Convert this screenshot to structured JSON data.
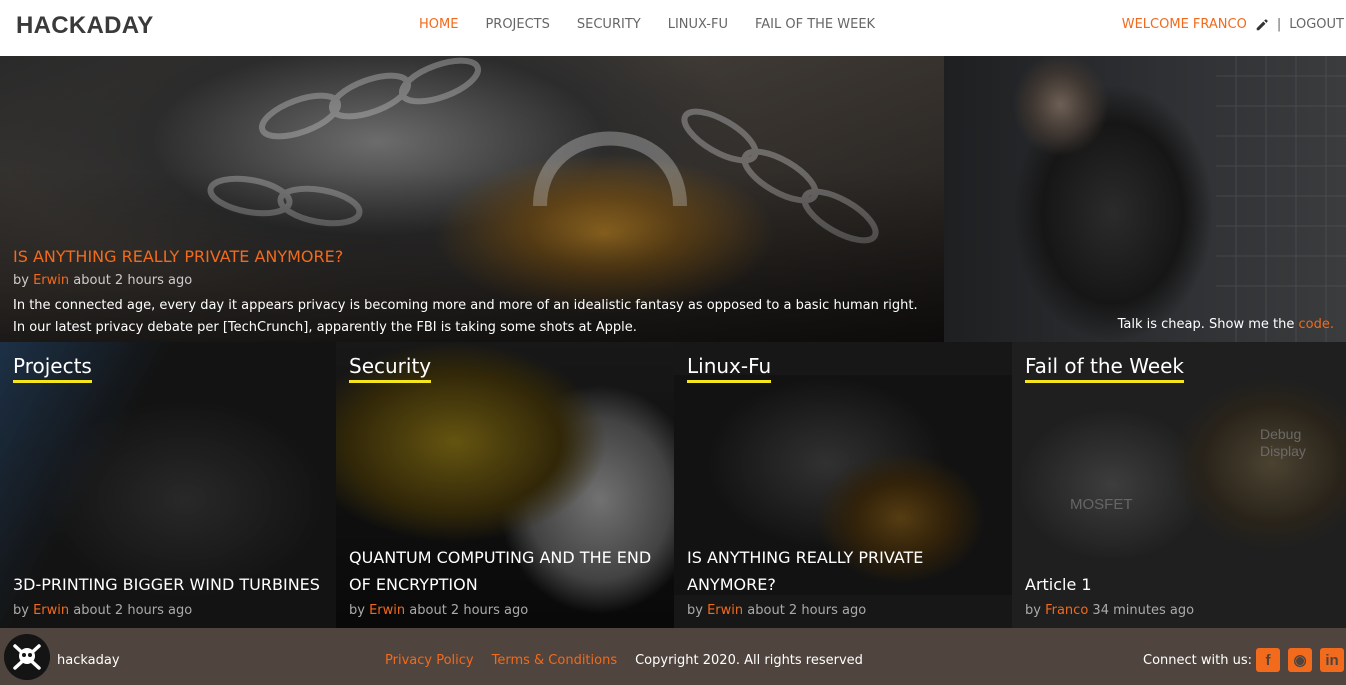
{
  "header": {
    "logo": "HACKADAY",
    "nav": [
      {
        "label": "HOME",
        "active": true
      },
      {
        "label": "PROJECTS",
        "active": false
      },
      {
        "label": "SECURITY",
        "active": false
      },
      {
        "label": "LINUX-FU",
        "active": false
      },
      {
        "label": "FAIL OF THE WEEK",
        "active": false
      }
    ],
    "welcome": "WELCOME FRANCO",
    "separator": "|",
    "logout": "LOGOUT"
  },
  "hero": {
    "title": "IS ANYTHING REALLY PRIVATE ANYMORE?",
    "by": "by",
    "author": "Erwin",
    "time": "about 2 hours ago",
    "line1": "In the connected age, every day it appears privacy is becoming more and more of an idealistic fantasy as opposed to a basic human right.",
    "line2": "In our latest privacy debate per [TechCrunch], apparently the FBI is taking some shots at Apple."
  },
  "side": {
    "quote": "Talk is cheap. Show me the",
    "link": "code."
  },
  "cards": [
    {
      "category": "Projects",
      "title": "3D-PRINTING BIGGER WIND TURBINES",
      "by": "by",
      "author": "Erwin",
      "time": "about 2 hours ago"
    },
    {
      "category": "Security",
      "title": "QUANTUM COMPUTING AND THE END OF ENCRYPTION",
      "by": "by",
      "author": "Erwin",
      "time": "about 2 hours ago"
    },
    {
      "category": "Linux-Fu",
      "title": "IS ANYTHING REALLY PRIVATE ANYMORE?",
      "by": "by",
      "author": "Erwin",
      "time": "about 2 hours ago"
    },
    {
      "category": "Fail of the Week",
      "title": "Article 1",
      "by": "by",
      "author": "Franco",
      "time": "34 minutes ago",
      "image_text_1": "MOSFET",
      "image_text_2": "Debug Display"
    }
  ],
  "footer": {
    "name": "hackaday",
    "privacy": "Privacy Policy",
    "terms": "Terms & Conditions",
    "copyright": "Copyright 2020. All rights reserved",
    "connect": "Connect with us:",
    "socials": [
      {
        "icon": "facebook-icon",
        "glyph": "f"
      },
      {
        "icon": "github-icon",
        "glyph": "◉"
      },
      {
        "icon": "linkedin-icon",
        "glyph": "in"
      }
    ]
  },
  "colors": {
    "accent": "#f26a1b",
    "underline": "#f5e51d",
    "footer_bg": "#4f443e"
  }
}
